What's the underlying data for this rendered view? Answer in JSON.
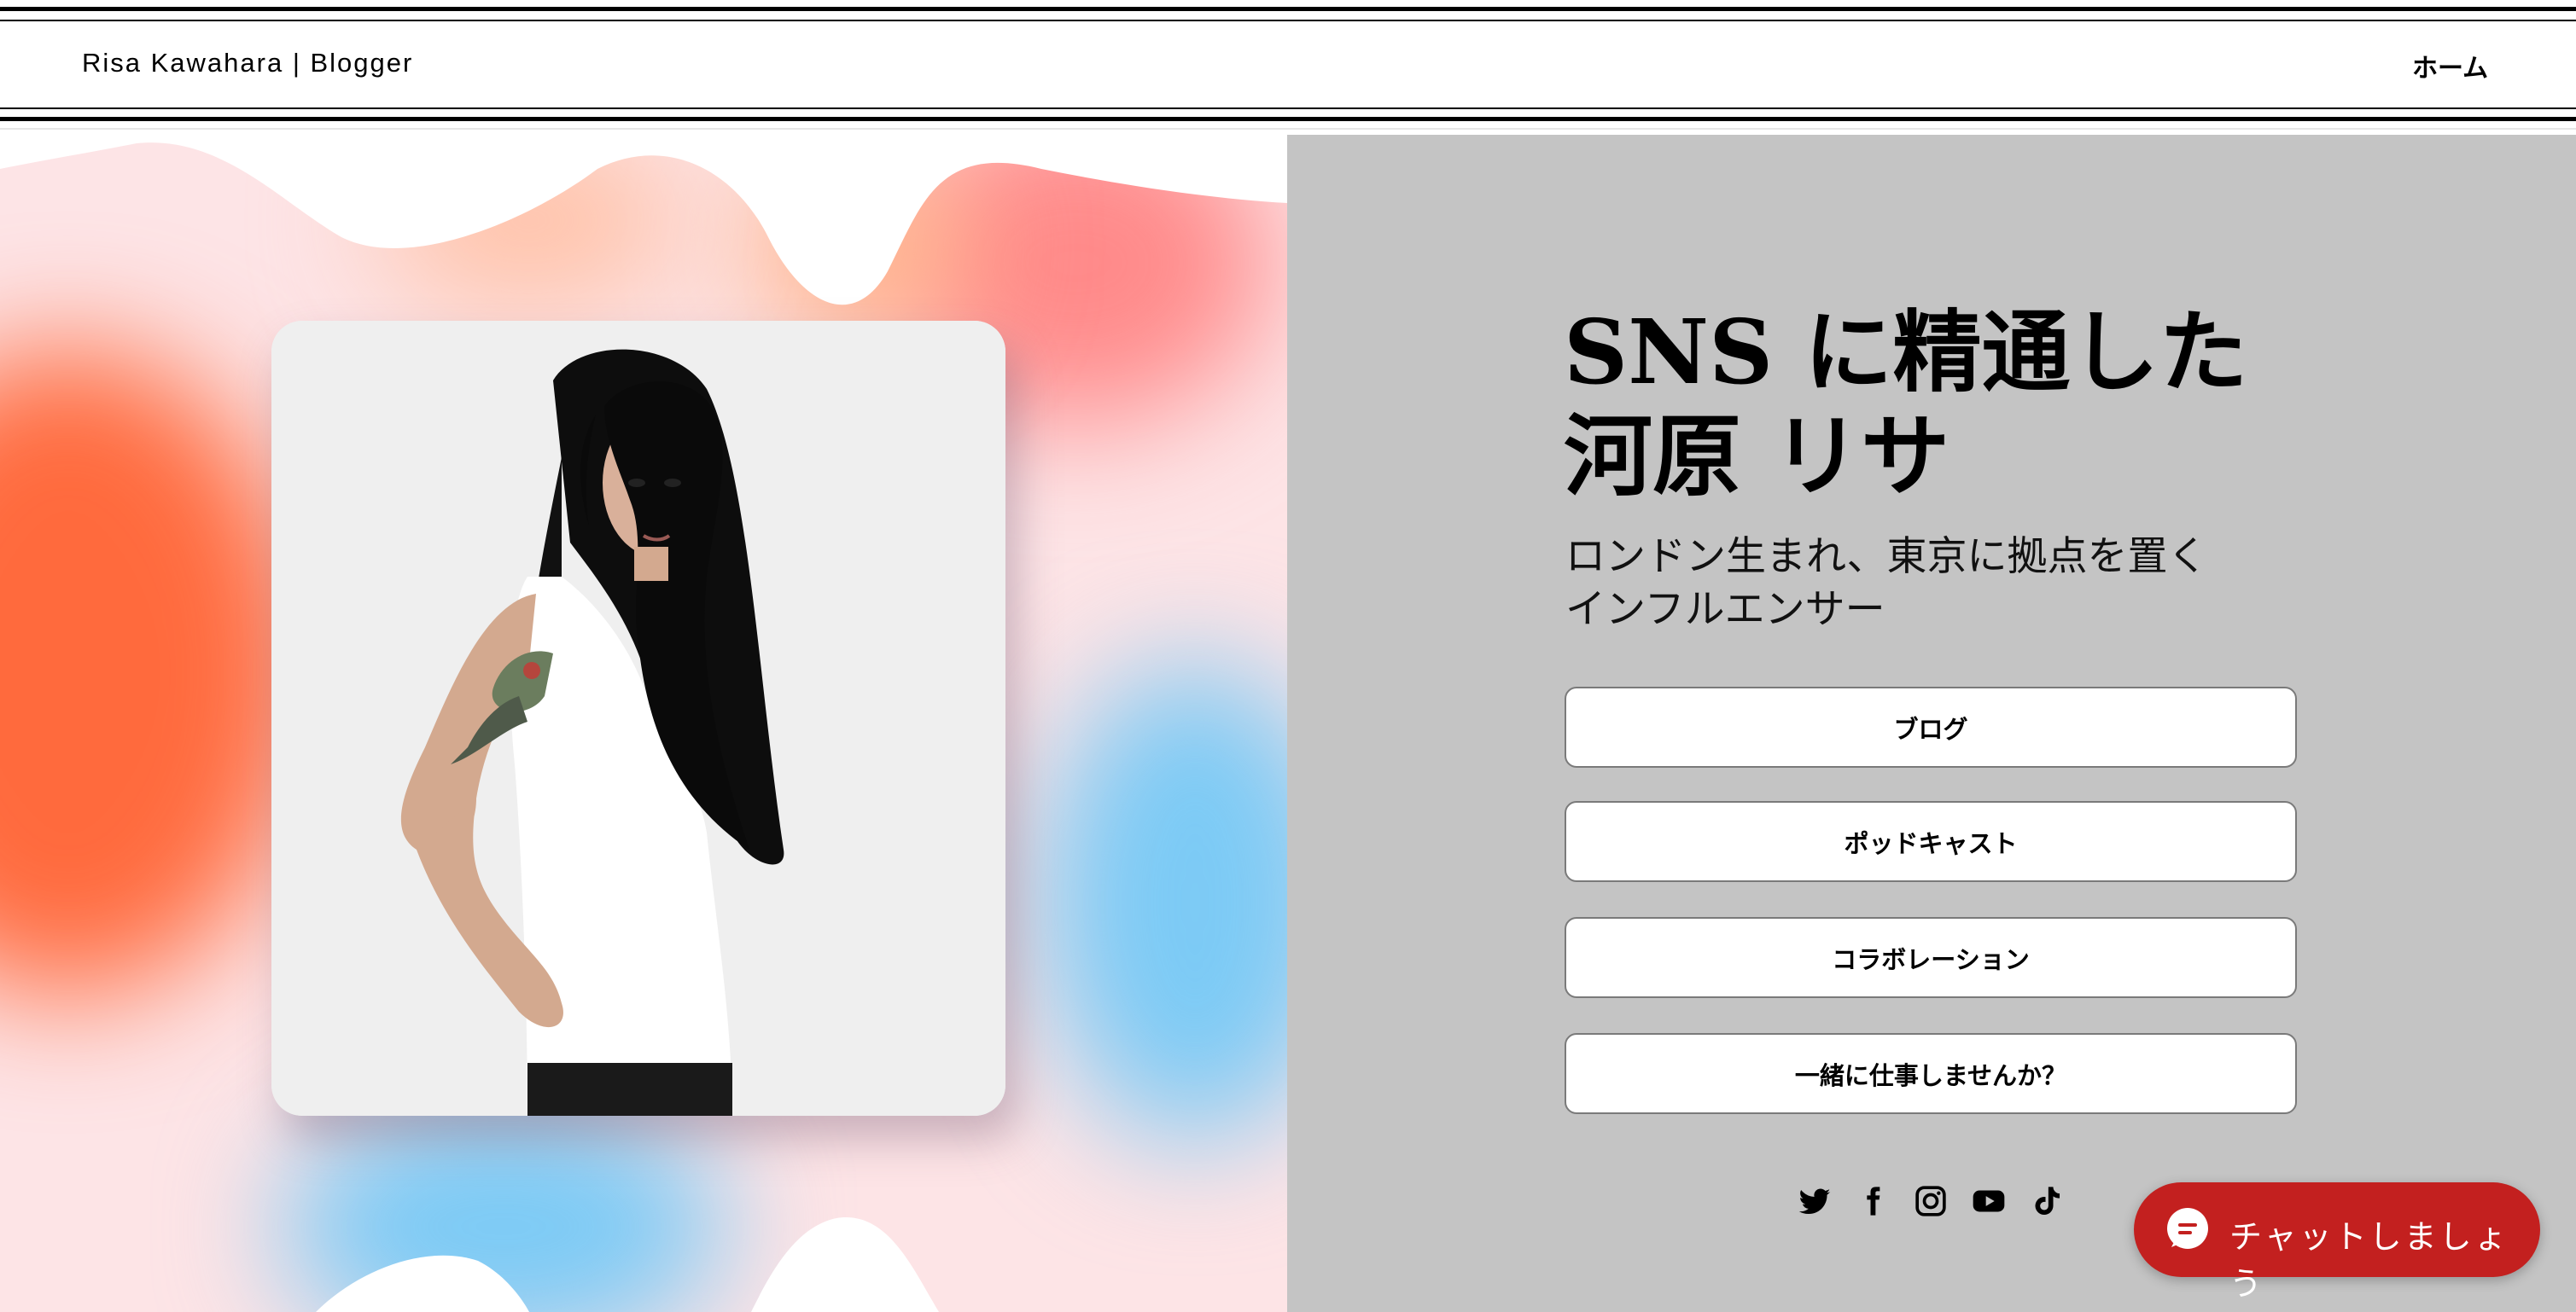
{
  "header": {
    "brand": "Risa Kawahara | Blogger",
    "nav_home": "ホーム"
  },
  "hero": {
    "title_line1": "SNS に精通した",
    "title_line2": "河原 リサ",
    "subtitle_line1": "ロンドン生まれ、東京に拠点を置く",
    "subtitle_line2": "インフルエンサー",
    "buttons": [
      "ブログ",
      "ポッドキャスト",
      "コラボレーション",
      "一緒に仕事しませんか？"
    ]
  },
  "social": [
    "twitter-icon",
    "facebook-icon",
    "instagram-icon",
    "youtube-icon",
    "tiktok-icon"
  ],
  "chat": {
    "label": "チャットしましょう"
  },
  "colors": {
    "right_panel": "#c4c4c4",
    "chat_button": "#c3201f",
    "blob_orange": "#ff6a3d",
    "blob_blue": "#7ccaf5",
    "blob_pink": "#ff8a8a"
  }
}
